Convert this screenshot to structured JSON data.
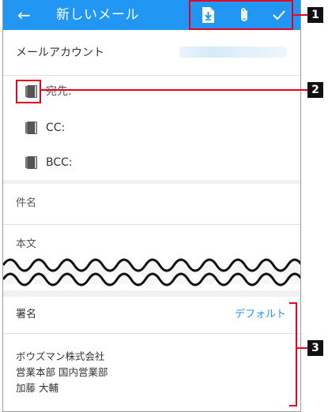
{
  "appbar": {
    "back_icon": "arrow-left-icon",
    "title": "新しいメール",
    "actions": [
      {
        "name": "template",
        "icon": "file-download-icon"
      },
      {
        "name": "attach",
        "icon": "paperclip-icon"
      },
      {
        "name": "send",
        "icon": "check-icon"
      }
    ],
    "bg_color": "#2196f3"
  },
  "form": {
    "account_label": "メールアカウント",
    "to_label": "宛先:",
    "cc_label": "CC:",
    "bcc_label": "BCC:",
    "address_book_icon": "address-book-icon",
    "subject_label": "件名",
    "body_label": "本文"
  },
  "signature": {
    "label": "署名",
    "selected": "デフォルト",
    "lines": [
      "ボウズマン株式会社",
      "営業本部 国内営業部",
      "加藤 大輔"
    ]
  },
  "callouts": [
    "1",
    "2",
    "3"
  ],
  "colors": {
    "accent": "#2196f3",
    "callout": "#e8001c"
  }
}
